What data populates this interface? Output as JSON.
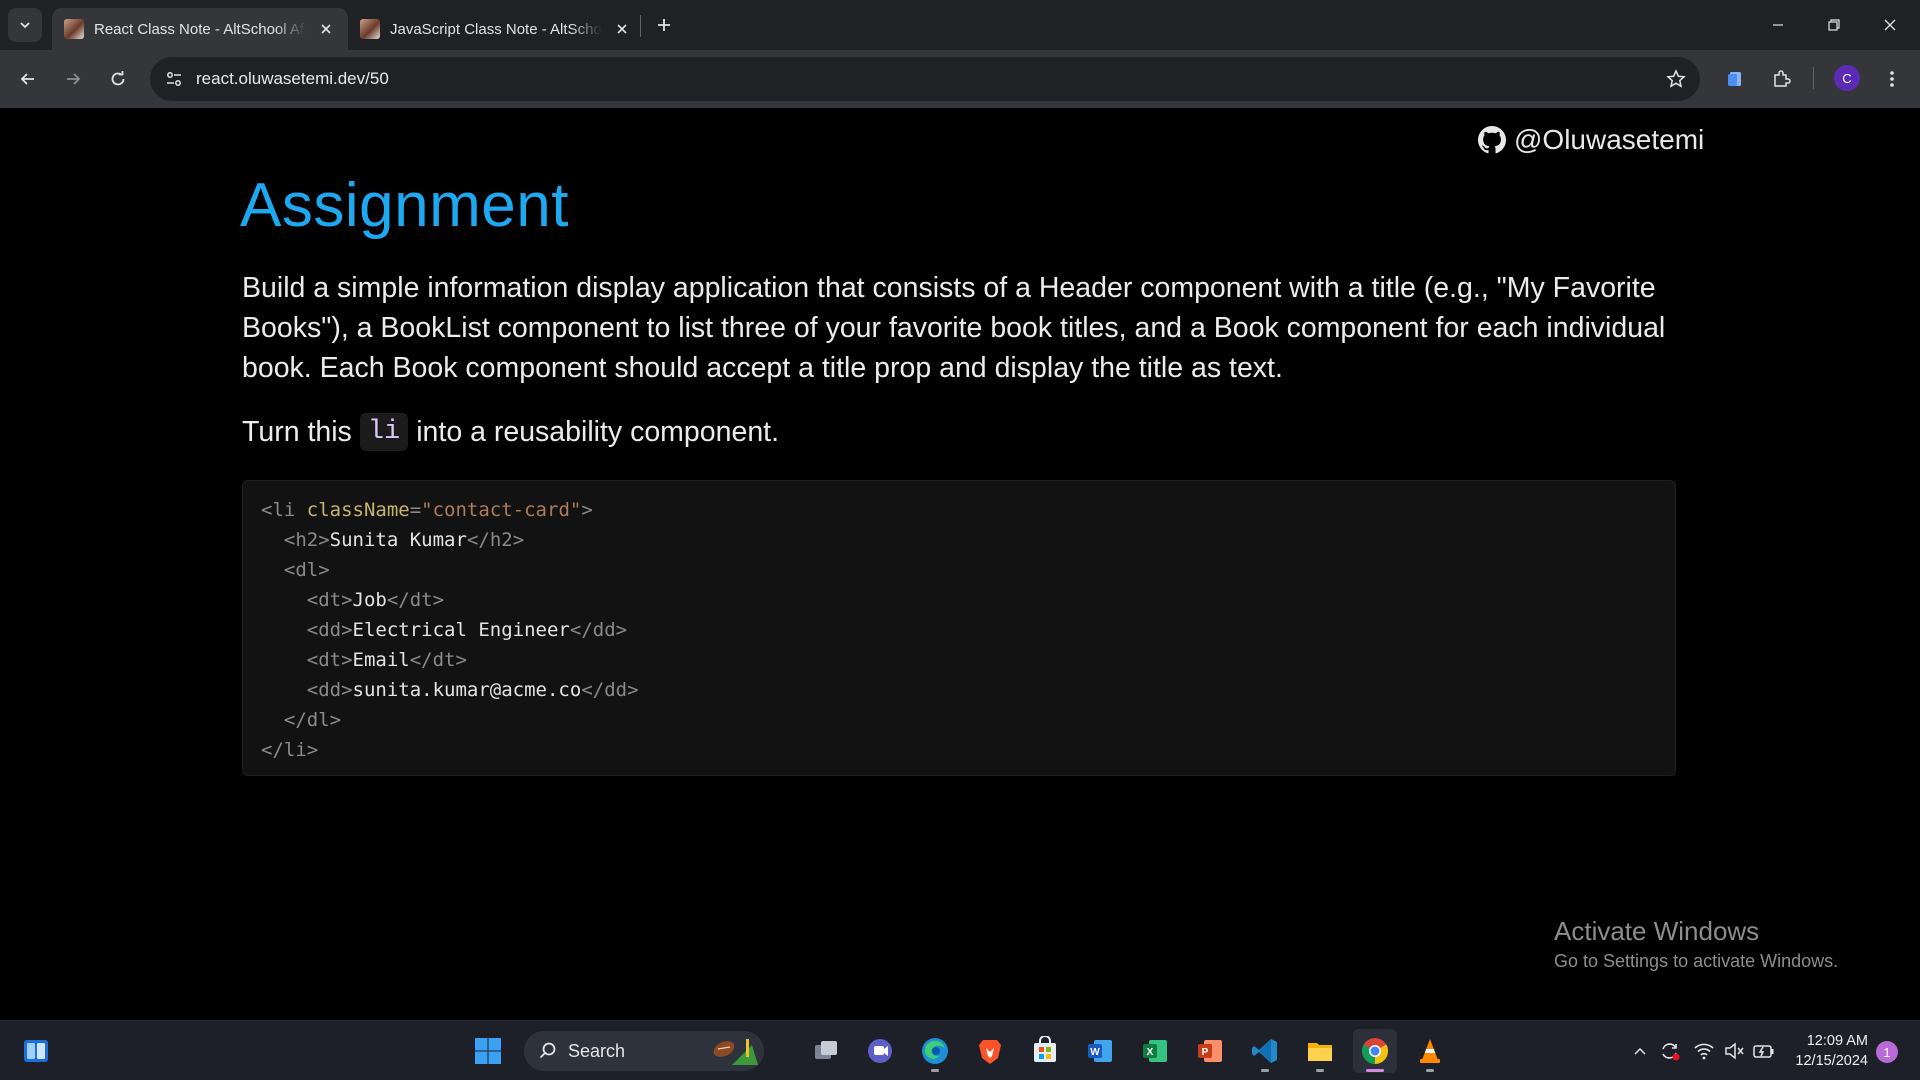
{
  "browser": {
    "tabs": [
      {
        "title": "React Class Note - AltSchool Africa",
        "active": true
      },
      {
        "title": "JavaScript Class Note - AltSchool Africa",
        "active": false
      }
    ],
    "url": "react.oluwasetemi.dev/50",
    "profile_initial": "C"
  },
  "page": {
    "github_handle": "@Oluwasetemi",
    "heading": "Assignment",
    "paragraph": "Build a simple information display application that consists of a Header component with a title (e.g., \"My Favorite Books\"), a BookList component to list three of your favorite book titles, and a Book component for each individual book. Each Book component should accept a title prop and display the title as text.",
    "turn_before": "Turn this",
    "turn_code": "li",
    "turn_after": "into a reusability component.",
    "code_lines": [
      {
        "indent": "",
        "open": "<li ",
        "attr": "className",
        "eq": "=",
        "str": "\"contact-card\"",
        "close": ">",
        "text": "",
        "end": ""
      },
      {
        "indent": "  ",
        "open": "<h2>",
        "attr": "",
        "eq": "",
        "str": "",
        "close": "",
        "text": "Sunita Kumar",
        "end": "</h2>"
      },
      {
        "indent": "  ",
        "open": "<dl>",
        "attr": "",
        "eq": "",
        "str": "",
        "close": "",
        "text": "",
        "end": ""
      },
      {
        "indent": "    ",
        "open": "<dt>",
        "attr": "",
        "eq": "",
        "str": "",
        "close": "",
        "text": "Job",
        "end": "</dt>"
      },
      {
        "indent": "    ",
        "open": "<dd>",
        "attr": "",
        "eq": "",
        "str": "",
        "close": "",
        "text": "Electrical Engineer",
        "end": "</dd>"
      },
      {
        "indent": "    ",
        "open": "<dt>",
        "attr": "",
        "eq": "",
        "str": "",
        "close": "",
        "text": "Email",
        "end": "</dt>"
      },
      {
        "indent": "    ",
        "open": "<dd>",
        "attr": "",
        "eq": "",
        "str": "",
        "close": "",
        "text": "sunita.kumar@acme.co",
        "end": "</dd>"
      },
      {
        "indent": "  ",
        "open": "</dl>",
        "attr": "",
        "eq": "",
        "str": "",
        "close": "",
        "text": "",
        "end": ""
      },
      {
        "indent": "",
        "open": "</li>",
        "attr": "",
        "eq": "",
        "str": "",
        "close": "",
        "text": "",
        "end": ""
      }
    ]
  },
  "watermark": {
    "line1": "Activate Windows",
    "line2": "Go to Settings to activate Windows."
  },
  "taskbar": {
    "search_label": "Search",
    "time": "12:09 AM",
    "date": "12/15/2024",
    "notification_count": "1"
  },
  "colors": {
    "heading": "#1ea8f0",
    "background": "#000000",
    "taskbar": "#1d2029",
    "tab_active": "#35363a"
  }
}
